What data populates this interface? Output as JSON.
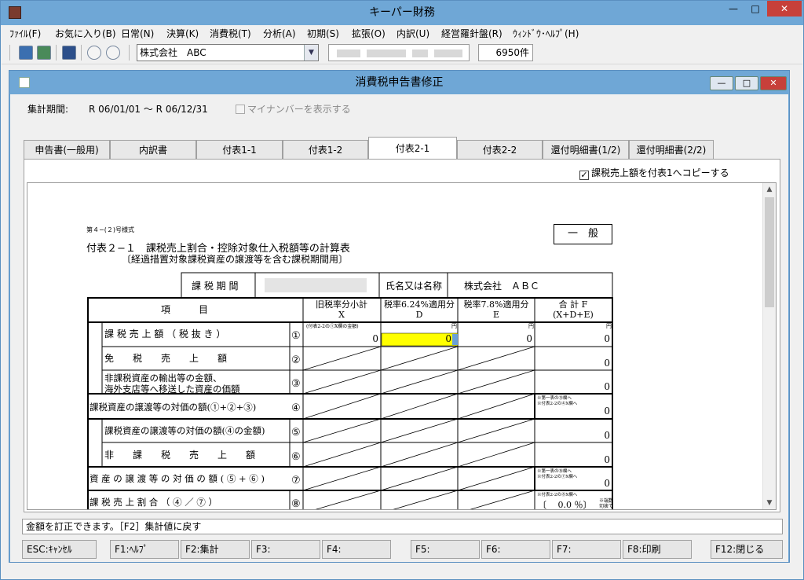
{
  "window": {
    "title": "キーパー財務",
    "min": "—",
    "max": "□",
    "close": "✕"
  },
  "menu": [
    "ﾌｧｲﾙ(F)",
    "お気に入り(B)",
    "日常(N)",
    "決算(K)",
    "消費税(T)",
    "分析(A)",
    "初期(S)",
    "拡張(O)",
    "内訳(U)",
    "経営羅針盤(R)",
    "ｳｨﾝﾄﾞｳ･ﾍﾙﾌﾟ(H)"
  ],
  "toolbar": {
    "company": "株式会社　ABC",
    "count": "6950件",
    "icons": [
      "save-icon",
      "refresh-icon",
      "monitor-icon",
      "zoom-in-icon",
      "zoom-out-icon"
    ]
  },
  "dialog": {
    "title": "消費税申告書修正",
    "period_label": "集計期間:",
    "period_value": "R 06/01/01 〜 R 06/12/31",
    "mynumber_label": "マイナンバーを表示する",
    "mynumber_checked": false
  },
  "tabs": [
    {
      "label": "申告書(一般用)",
      "active": false
    },
    {
      "label": "内訳書",
      "active": false
    },
    {
      "label": "付表1-1",
      "active": false
    },
    {
      "label": "付表1-2",
      "active": false
    },
    {
      "label": "付表2-1",
      "active": true
    },
    {
      "label": "付表2-2",
      "active": false
    },
    {
      "label": "還付明細書(1/2)",
      "active": false
    },
    {
      "label": "還付明細書(2/2)",
      "active": false
    }
  ],
  "panel": {
    "copy_label": "課税売上額を付表1へコピーする",
    "copy_checked": true,
    "check_mark": "✓"
  },
  "form": {
    "form_no": "第４−(２)号様式",
    "title1": "付表２−１　課税売上割合・控除対象仕入税額等の計算表",
    "title2": "〔経過措置対象課税資産の譲渡等を含む課税期間用〕",
    "ippan": "一　般",
    "period_header": "課 税 期 間",
    "name_header": "氏名又は名称",
    "name_value": "株式会社　ＡＢＣ",
    "item_header": "項　　　目",
    "col_x": "旧税率分小計",
    "col_x_sub": "X",
    "col_d": "税率6.24%適用分",
    "col_d_sub": "D",
    "col_e": "税率7.8%適用分",
    "col_e_sub": "E",
    "col_f": "合 計 F",
    "col_f_sub": "(X+D+E)",
    "note_x1": "(付表2-2の①X欄の金額)",
    "yen": "円",
    "note_f": "※第一表の⑬欄へ",
    "note_f2": "※付表2-2の④X欄へ",
    "note_f7a": "※第一表の⑯欄へ",
    "note_f7b": "※付表2-2の⑦X欄へ",
    "note_f8": "※付表2-2の⑧X欄へ",
    "note_f8b": "※端数",
    "note_f8c": "切捨て",
    "rows": [
      {
        "label": "課 税 売 上 額 （ 税 抜 き ）",
        "no": "①",
        "x": "0",
        "d": "0",
        "e": "0",
        "f": "0"
      },
      {
        "label": "免　　税　　売　　上　　額",
        "no": "②",
        "f": "0"
      },
      {
        "label": "非課税資産の輸出等の金額、",
        "label2": "海外支店等へ移送した資産の価額",
        "no": "③",
        "f": "0"
      },
      {
        "label": "課税資産の譲渡等の対価の額(①+②+③)",
        "no": "④",
        "f": "0"
      },
      {
        "label": "課税資産の譲渡等の対価の額(④の金額)",
        "no": "⑤",
        "f": "0"
      },
      {
        "label": "非　　課　　税　　売　　上　　額",
        "no": "⑥",
        "f": "0"
      },
      {
        "label": "資 産 の 譲 渡 等 の 対 価 の 額 ( ⑤ + ⑥ )",
        "no": "⑦",
        "f": "0"
      },
      {
        "label": "課 税 売 上 割 合 （ ④ ／ ⑦ ）",
        "no": "⑧",
        "f": "〔　 0.0 ％〕"
      }
    ]
  },
  "status": "金額を訂正できます。［F2］集計値に戻す",
  "fkeys": [
    "ESC:ｷｬﾝｾﾙ",
    "F1:ﾍﾙﾌﾟ",
    "F2:集計",
    "F3:",
    "F4:",
    "F5:",
    "F6:",
    "F7:",
    "F8:印刷",
    "F12:閉じる"
  ],
  "colors": {
    "titlebar": "#6fa7d6",
    "highlight_cell": "#ffff00",
    "close": "#c7403a"
  }
}
